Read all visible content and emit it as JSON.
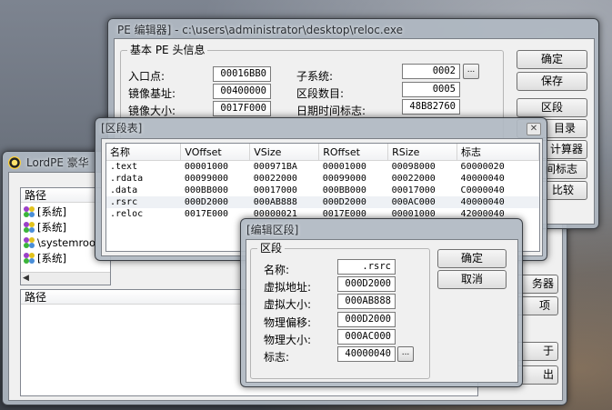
{
  "pe_editor": {
    "title": "PE 编辑器] - c:\\users\\administrator\\desktop\\reloc.exe",
    "header_group": "基本 PE 头信息",
    "fields": [
      {
        "label": "入口点:",
        "value": "00016BB0"
      },
      {
        "label": "镜像基址:",
        "value": "00400000"
      },
      {
        "label": "镜像大小:",
        "value": "0017F000"
      }
    ],
    "right_fields": [
      {
        "label": "子系统:",
        "value": "0002"
      },
      {
        "label": "区段数目:",
        "value": "0005"
      },
      {
        "label": "日期时间标志:",
        "value": "48B82760"
      }
    ],
    "buttons": [
      "确定",
      "保存",
      "区段",
      "目录",
      "计算器",
      "间标志",
      "比较"
    ]
  },
  "lordpe": {
    "title": "LordPE 豪华",
    "path_header": "路径",
    "processes": [
      {
        "name": "[系统]",
        "icon": "process-icon"
      },
      {
        "name": "[系统]",
        "icon": "process-icon"
      },
      {
        "name": "\\systemroo",
        "icon": "process-icon"
      },
      {
        "name": "[系统]",
        "icon": "process-icon"
      }
    ],
    "modules_header": "路径",
    "side_buttons": [
      "务器",
      "项",
      "于",
      "出"
    ]
  },
  "section_table": {
    "title": "[区段表]",
    "columns": [
      "名称",
      "VOffset",
      "VSize",
      "ROffset",
      "RSize",
      "标志"
    ],
    "rows": [
      [
        ".text",
        "00001000",
        "000971BA",
        "00001000",
        "00098000",
        "60000020"
      ],
      [
        ".rdata",
        "00099000",
        "00022000",
        "00099000",
        "00022000",
        "40000040"
      ],
      [
        ".data",
        "000BB000",
        "00017000",
        "000BB000",
        "00017000",
        "C0000040"
      ],
      [
        ".rsrc",
        "000D2000",
        "000AB888",
        "000D2000",
        "000AC000",
        "40000040"
      ],
      [
        ".reloc",
        "0017E000",
        "00000021",
        "0017E000",
        "00001000",
        "42000040"
      ]
    ]
  },
  "edit_section": {
    "title": "[编辑区段]",
    "group": "区段",
    "fields": [
      {
        "label": "名称:",
        "value": ".rsrc"
      },
      {
        "label": "虚拟地址:",
        "value": "000D2000"
      },
      {
        "label": "虚拟大小:",
        "value": "000AB888"
      },
      {
        "label": "物理偏移:",
        "value": "000D2000"
      },
      {
        "label": "物理大小:",
        "value": "000AC000"
      },
      {
        "label": "标志:",
        "value": "40000040"
      }
    ],
    "ok": "确定",
    "cancel": "取消",
    "ellipsis": "..."
  },
  "colors": {
    "window_frame": "#b0b8c2",
    "client": "#f0f0f0",
    "selected_row": "#eef1f5"
  }
}
